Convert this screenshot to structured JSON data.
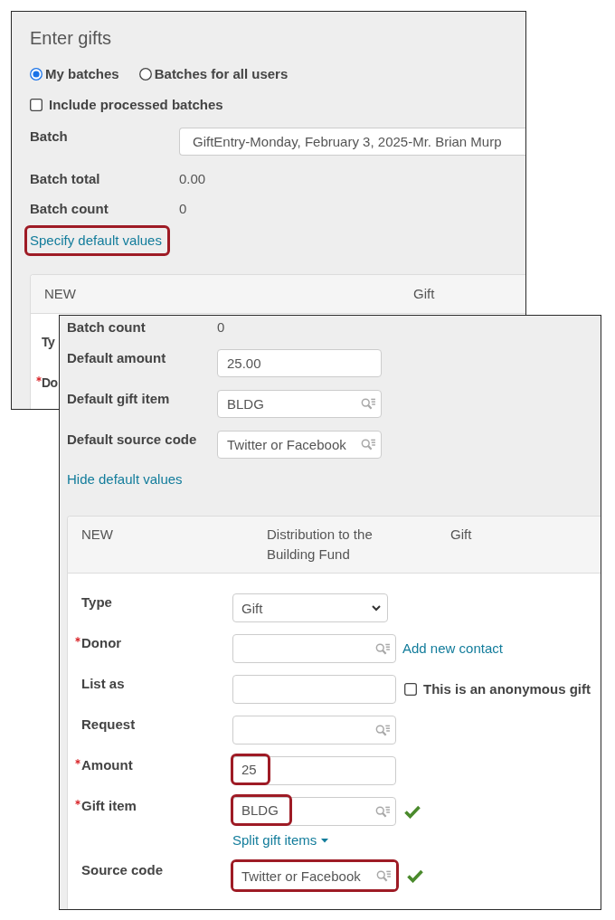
{
  "background_panel": {
    "title": "Enter gifts",
    "batch_filter": [
      {
        "label": "My batches",
        "selected": true
      },
      {
        "label": "Batches for all users",
        "selected": false
      }
    ],
    "include_processed": {
      "label": "Include processed batches",
      "checked": false
    },
    "batch": {
      "label": "Batch",
      "value": "GiftEntry-Monday, February 3, 2025-Mr. Brian Murp"
    },
    "summary": [
      {
        "label": "Batch total",
        "value": "0.00"
      },
      {
        "label": "Batch count",
        "value": "0"
      }
    ],
    "defaults_link": {
      "label": "Specify default values",
      "highlighted": true
    },
    "entry_card": {
      "header": {
        "status": "NEW",
        "type": "Gift"
      },
      "fields": [
        {
          "label": "Ty",
          "required": false
        },
        {
          "label": "Do",
          "required": true
        }
      ]
    }
  },
  "foreground_panel": {
    "summary": [
      {
        "label": "Batch count",
        "value": "0"
      }
    ],
    "defaults": [
      {
        "label": "Default amount",
        "kind": "text",
        "value": "25.00"
      },
      {
        "label": "Default gift item",
        "kind": "lookup",
        "value": "BLDG"
      },
      {
        "label": "Default source code",
        "kind": "lookup",
        "value": "Twitter or Facebook"
      }
    ],
    "hide_link": {
      "label": "Hide default values"
    },
    "entry_card": {
      "header": {
        "status": "NEW",
        "description": "Distribution to the Building Fund",
        "type": "Gift"
      },
      "fields": [
        {
          "label": "Type",
          "kind": "select",
          "value": "Gift",
          "required": false,
          "value_highlighted": false,
          "field_highlighted": false,
          "valid": false
        },
        {
          "label": "Donor",
          "kind": "lookup",
          "required": true,
          "value_highlighted": false,
          "field_highlighted": false,
          "valid": false,
          "action": {
            "kind": "link",
            "label": "Add new contact"
          }
        },
        {
          "label": "List as",
          "kind": "text",
          "required": false,
          "value_highlighted": false,
          "field_highlighted": false,
          "valid": false,
          "action": {
            "kind": "checkbox",
            "label": "This is an anonymous gift",
            "checked": false
          }
        },
        {
          "label": "Request",
          "kind": "lookup",
          "required": false,
          "value_highlighted": false,
          "field_highlighted": false,
          "valid": false
        },
        {
          "label": "Amount",
          "kind": "text",
          "value": "25",
          "required": true,
          "value_highlighted": true,
          "field_highlighted": false,
          "valid": false
        },
        {
          "label": "Gift item",
          "kind": "lookup",
          "value": "BLDG",
          "required": true,
          "value_highlighted": true,
          "field_highlighted": false,
          "valid": true,
          "link": {
            "label": "Split gift items"
          }
        },
        {
          "label": "Source code",
          "kind": "lookup",
          "value": "Twitter or Facebook",
          "required": false,
          "value_highlighted": false,
          "field_highlighted": true,
          "valid": true
        }
      ]
    }
  }
}
